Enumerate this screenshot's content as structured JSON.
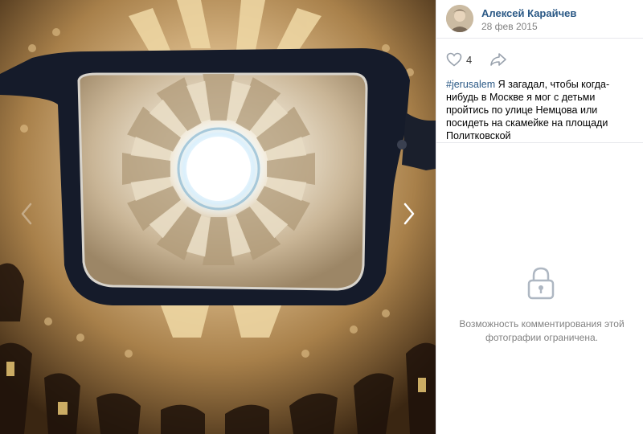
{
  "post": {
    "author_name": "Алексей Карайчев",
    "date": "28 фев 2015",
    "likes": "4",
    "hashtag": "#jerusalem",
    "caption": " Я загадал, чтобы когда-нибудь в Москве я мог с детьми пройтись по улице Немцова или посидеть на скамейке на площади Политковской"
  },
  "comments": {
    "closed_message": "Возможность комментирования этой фотографии ограничена."
  },
  "icons": {
    "like": "heart-icon",
    "share": "share-arrow-icon",
    "lock": "lock-icon",
    "prev": "chevron-left-icon",
    "next": "chevron-right-icon"
  },
  "colors": {
    "link": "#2a5885",
    "muted": "#828282",
    "border": "#e7e8ec"
  }
}
